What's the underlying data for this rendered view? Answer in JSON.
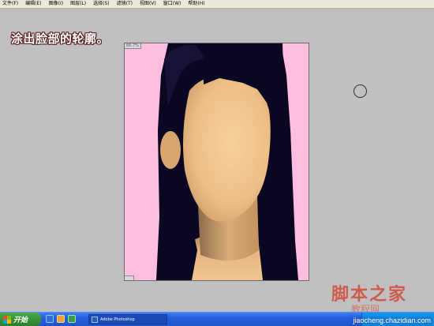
{
  "menu": {
    "items": [
      "文件(F)",
      "编辑(E)",
      "图像(I)",
      "图层(L)",
      "选择(S)",
      "滤镜(T)",
      "视图(V)",
      "窗口(W)",
      "帮助(H)"
    ]
  },
  "caption": "涂出脸部的轮廓。",
  "document": {
    "zoom": "66.7%"
  },
  "watermark": {
    "logo": "脚本之家",
    "site": "教程网",
    "url": "jiaocheng.chazidian.com"
  },
  "taskbar": {
    "start_label": "开始",
    "photoshop_task": "Adobe Photoshop"
  },
  "colors": {
    "workspace": "#c0c0c0",
    "canvas_bg": "#ffbde0",
    "hair": "#0a0722",
    "skin": "#f0c590",
    "taskbar": "#245edb",
    "start_green": "#379337"
  },
  "icons": {
    "brush_cursor": "circle-brush-cursor-icon",
    "start": "windows-logo-icon",
    "photoshop": "photoshop-icon"
  }
}
